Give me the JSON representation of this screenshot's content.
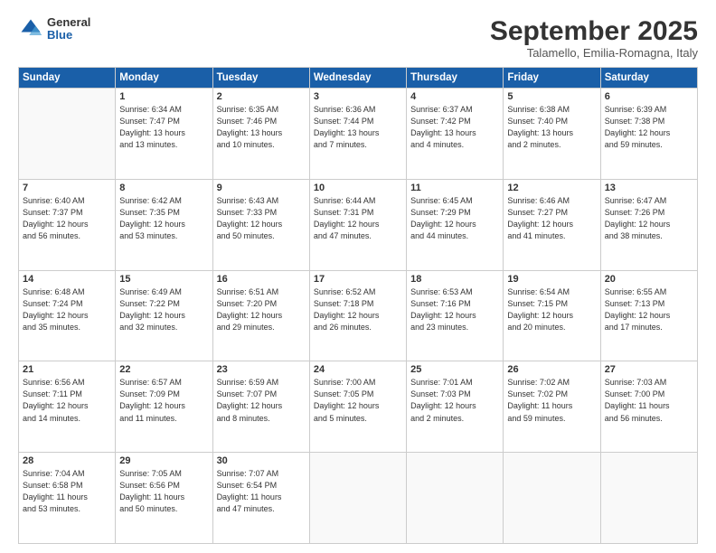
{
  "logo": {
    "general": "General",
    "blue": "Blue"
  },
  "header": {
    "month": "September 2025",
    "location": "Talamello, Emilia-Romagna, Italy"
  },
  "weekdays": [
    "Sunday",
    "Monday",
    "Tuesday",
    "Wednesday",
    "Thursday",
    "Friday",
    "Saturday"
  ],
  "weeks": [
    [
      {
        "day": "",
        "info": ""
      },
      {
        "day": "1",
        "info": "Sunrise: 6:34 AM\nSunset: 7:47 PM\nDaylight: 13 hours\nand 13 minutes."
      },
      {
        "day": "2",
        "info": "Sunrise: 6:35 AM\nSunset: 7:46 PM\nDaylight: 13 hours\nand 10 minutes."
      },
      {
        "day": "3",
        "info": "Sunrise: 6:36 AM\nSunset: 7:44 PM\nDaylight: 13 hours\nand 7 minutes."
      },
      {
        "day": "4",
        "info": "Sunrise: 6:37 AM\nSunset: 7:42 PM\nDaylight: 13 hours\nand 4 minutes."
      },
      {
        "day": "5",
        "info": "Sunrise: 6:38 AM\nSunset: 7:40 PM\nDaylight: 13 hours\nand 2 minutes."
      },
      {
        "day": "6",
        "info": "Sunrise: 6:39 AM\nSunset: 7:38 PM\nDaylight: 12 hours\nand 59 minutes."
      }
    ],
    [
      {
        "day": "7",
        "info": "Sunrise: 6:40 AM\nSunset: 7:37 PM\nDaylight: 12 hours\nand 56 minutes."
      },
      {
        "day": "8",
        "info": "Sunrise: 6:42 AM\nSunset: 7:35 PM\nDaylight: 12 hours\nand 53 minutes."
      },
      {
        "day": "9",
        "info": "Sunrise: 6:43 AM\nSunset: 7:33 PM\nDaylight: 12 hours\nand 50 minutes."
      },
      {
        "day": "10",
        "info": "Sunrise: 6:44 AM\nSunset: 7:31 PM\nDaylight: 12 hours\nand 47 minutes."
      },
      {
        "day": "11",
        "info": "Sunrise: 6:45 AM\nSunset: 7:29 PM\nDaylight: 12 hours\nand 44 minutes."
      },
      {
        "day": "12",
        "info": "Sunrise: 6:46 AM\nSunset: 7:27 PM\nDaylight: 12 hours\nand 41 minutes."
      },
      {
        "day": "13",
        "info": "Sunrise: 6:47 AM\nSunset: 7:26 PM\nDaylight: 12 hours\nand 38 minutes."
      }
    ],
    [
      {
        "day": "14",
        "info": "Sunrise: 6:48 AM\nSunset: 7:24 PM\nDaylight: 12 hours\nand 35 minutes."
      },
      {
        "day": "15",
        "info": "Sunrise: 6:49 AM\nSunset: 7:22 PM\nDaylight: 12 hours\nand 32 minutes."
      },
      {
        "day": "16",
        "info": "Sunrise: 6:51 AM\nSunset: 7:20 PM\nDaylight: 12 hours\nand 29 minutes."
      },
      {
        "day": "17",
        "info": "Sunrise: 6:52 AM\nSunset: 7:18 PM\nDaylight: 12 hours\nand 26 minutes."
      },
      {
        "day": "18",
        "info": "Sunrise: 6:53 AM\nSunset: 7:16 PM\nDaylight: 12 hours\nand 23 minutes."
      },
      {
        "day": "19",
        "info": "Sunrise: 6:54 AM\nSunset: 7:15 PM\nDaylight: 12 hours\nand 20 minutes."
      },
      {
        "day": "20",
        "info": "Sunrise: 6:55 AM\nSunset: 7:13 PM\nDaylight: 12 hours\nand 17 minutes."
      }
    ],
    [
      {
        "day": "21",
        "info": "Sunrise: 6:56 AM\nSunset: 7:11 PM\nDaylight: 12 hours\nand 14 minutes."
      },
      {
        "day": "22",
        "info": "Sunrise: 6:57 AM\nSunset: 7:09 PM\nDaylight: 12 hours\nand 11 minutes."
      },
      {
        "day": "23",
        "info": "Sunrise: 6:59 AM\nSunset: 7:07 PM\nDaylight: 12 hours\nand 8 minutes."
      },
      {
        "day": "24",
        "info": "Sunrise: 7:00 AM\nSunset: 7:05 PM\nDaylight: 12 hours\nand 5 minutes."
      },
      {
        "day": "25",
        "info": "Sunrise: 7:01 AM\nSunset: 7:03 PM\nDaylight: 12 hours\nand 2 minutes."
      },
      {
        "day": "26",
        "info": "Sunrise: 7:02 AM\nSunset: 7:02 PM\nDaylight: 11 hours\nand 59 minutes."
      },
      {
        "day": "27",
        "info": "Sunrise: 7:03 AM\nSunset: 7:00 PM\nDaylight: 11 hours\nand 56 minutes."
      }
    ],
    [
      {
        "day": "28",
        "info": "Sunrise: 7:04 AM\nSunset: 6:58 PM\nDaylight: 11 hours\nand 53 minutes."
      },
      {
        "day": "29",
        "info": "Sunrise: 7:05 AM\nSunset: 6:56 PM\nDaylight: 11 hours\nand 50 minutes."
      },
      {
        "day": "30",
        "info": "Sunrise: 7:07 AM\nSunset: 6:54 PM\nDaylight: 11 hours\nand 47 minutes."
      },
      {
        "day": "",
        "info": ""
      },
      {
        "day": "",
        "info": ""
      },
      {
        "day": "",
        "info": ""
      },
      {
        "day": "",
        "info": ""
      }
    ]
  ]
}
